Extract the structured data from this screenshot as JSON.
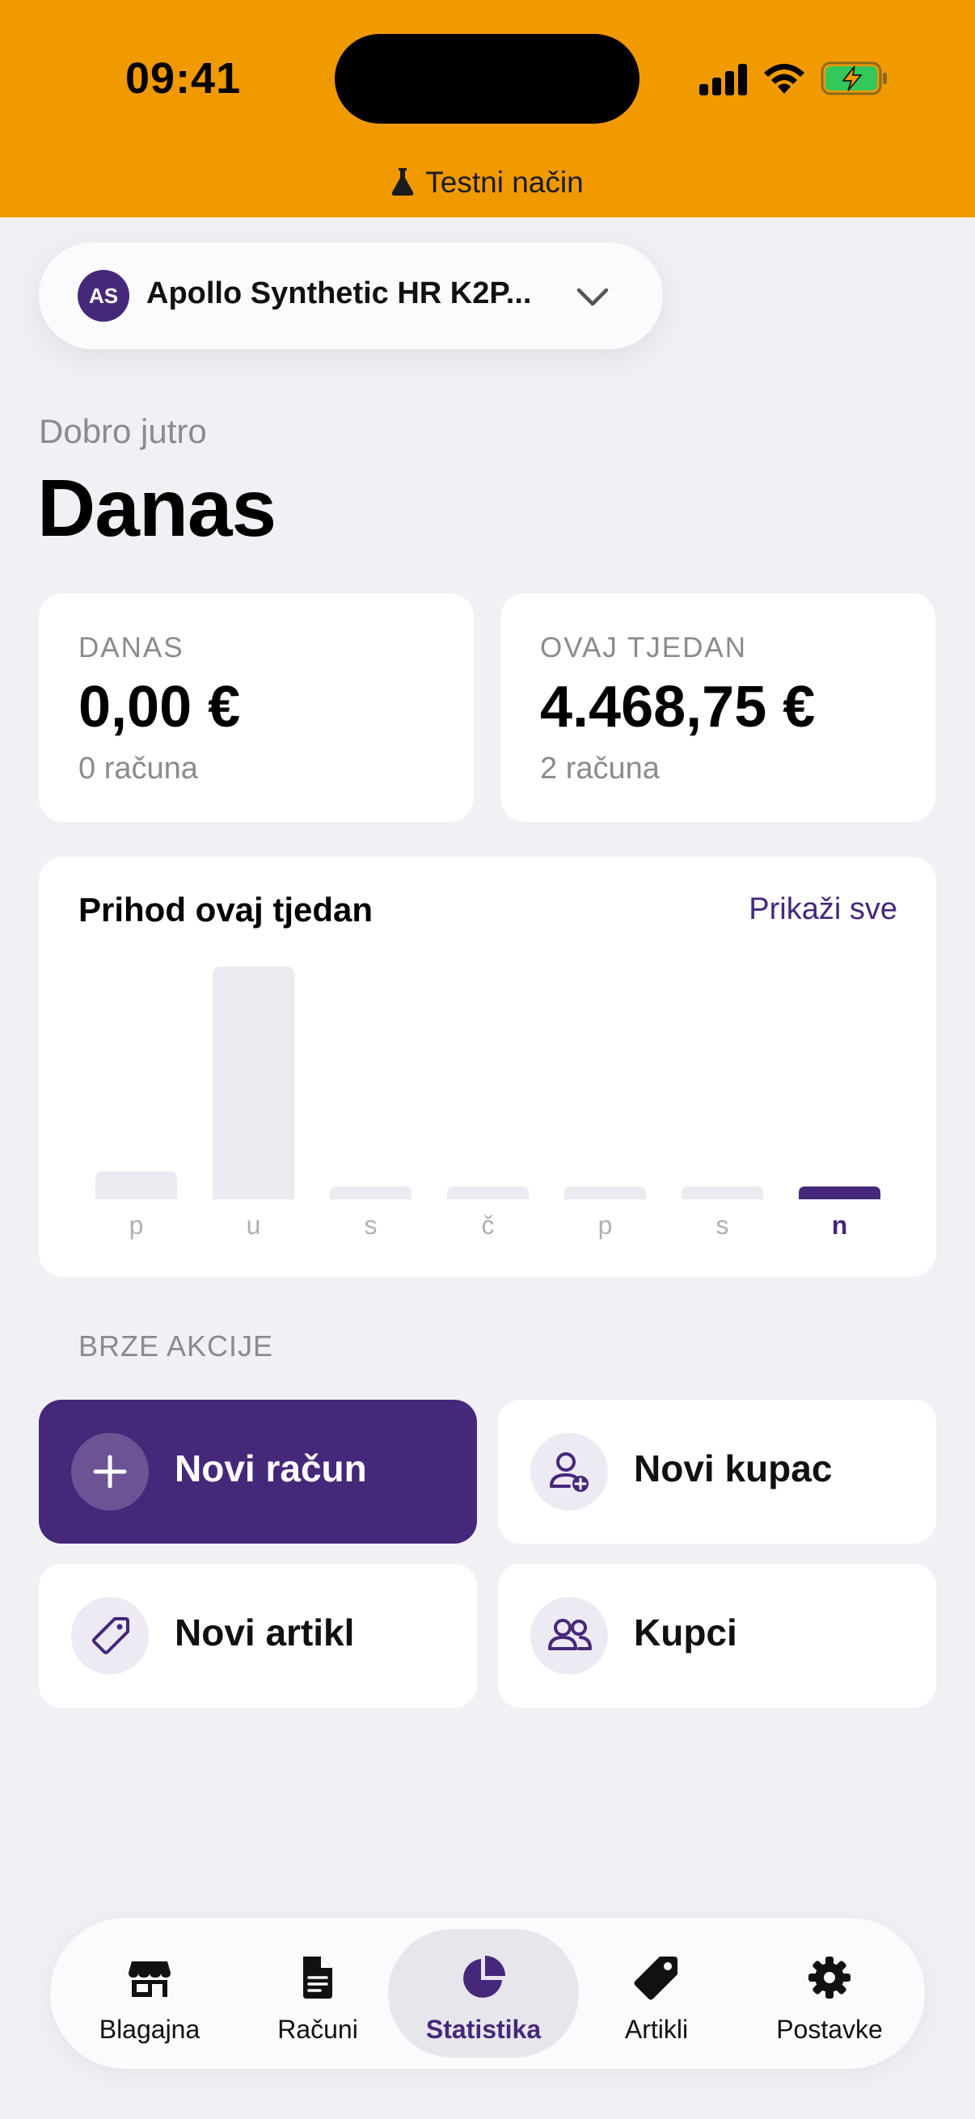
{
  "status_bar": {
    "time": "09:41",
    "test_mode": "Testni način"
  },
  "company": {
    "initials": "AS",
    "name": "Apollo Synthetic HR K2P..."
  },
  "greeting": "Dobro jutro",
  "title": "Danas",
  "stats": [
    {
      "label": "DANAS",
      "value": "0,00 €",
      "sub": "0 računa"
    },
    {
      "label": "OVAJ TJEDAN",
      "value": "4.468,75 €",
      "sub": "2 računa"
    }
  ],
  "chart": {
    "title": "Prihod ovaj tjedan",
    "link": "Prikaži sve"
  },
  "chart_data": {
    "type": "bar",
    "categories": [
      "p",
      "u",
      "s",
      "č",
      "p",
      "s",
      "n"
    ],
    "values": [
      0.12,
      1.0,
      0.055,
      0.055,
      0.055,
      0.055,
      0.055
    ],
    "highlight_index": 6,
    "colors": {
      "bar": "#ece9f0",
      "highlight": "#46287a",
      "label": "#b0afb5"
    }
  },
  "quick_actions": {
    "label": "BRZE AKCIJE",
    "items": [
      {
        "label": "Novi račun",
        "icon": "plus-icon"
      },
      {
        "label": "Novi kupac",
        "icon": "add-person-icon"
      },
      {
        "label": "Novi artikl",
        "icon": "tag-icon"
      },
      {
        "label": "Kupci",
        "icon": "people-icon"
      }
    ]
  },
  "tabs": [
    {
      "label": "Blagajna",
      "icon": "store-icon"
    },
    {
      "label": "Računi",
      "icon": "document-icon"
    },
    {
      "label": "Statistika",
      "icon": "pie-chart-icon",
      "active": true
    },
    {
      "label": "Artikli",
      "icon": "tag-icon"
    },
    {
      "label": "Postavke",
      "icon": "gear-icon"
    }
  ],
  "colors": {
    "accent": "#46287a",
    "status_bar": "#f09a00",
    "background": "#f1f0f5"
  }
}
